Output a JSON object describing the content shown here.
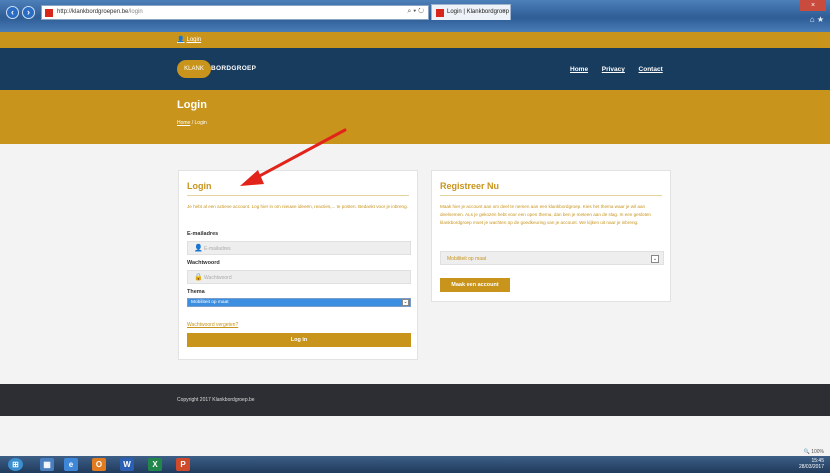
{
  "browser": {
    "url_host": "http://klankbordgroepen.be",
    "url_path": "/login",
    "address_controls": "⌕ ▾ ↻",
    "tab_title": "Login | Klankbordgroep",
    "tab_close": "×",
    "window_controls": "× ",
    "toolbar_icons": "⌂ ★"
  },
  "topbar": {
    "login_link": "Login"
  },
  "header": {
    "logo_badge": "KLANK",
    "logo_word": "BORDGROEP",
    "nav": [
      "Home",
      "Privacy",
      "Contact"
    ]
  },
  "banner": {
    "title": "Login",
    "breadcrumb": [
      "Home",
      "Login"
    ],
    "separator": "/"
  },
  "login_card": {
    "title": "Login",
    "description": "Je hebt al een actieve account. Log hier in om nieuwe ideeën, reacties,... te posten. Bedankt voor je inbreng.",
    "email_label": "E-mailadres",
    "email_placeholder": "E-mailadres",
    "password_label": "Wachtwoord",
    "password_placeholder": "Wachtwoord",
    "theme_label": "Thema",
    "theme_selected": "Mobiliteit op maat",
    "forgot_link": "Wachtwoord vergeten?",
    "submit_label": "Log in"
  },
  "register_card": {
    "title": "Registreer Nu",
    "description": "Maak hier je account aan om deel te nemen aan een klankbordgroep. Kies het thema waar je wil aan deelnemen. ALs je gekozen hebt voor een open thema, dan ben je meteen aan de slag. In een gesloten klankbordgroep moet je wachten op de goedkeuring van je account. We kijken uit naar je inbreng.",
    "theme_selected": "Mobiliteit op maat",
    "button_label": "Maak een account"
  },
  "footer": {
    "copyright": "Copyright 2017 Klankbordgroep.be"
  },
  "status": {
    "zoom": "100%"
  },
  "taskbar": {
    "clock_time": "15:45",
    "clock_date": "28/03/2017"
  },
  "colors": {
    "accent_gold": "#c8941c",
    "header_navy": "#173c5e",
    "footer_dark": "#2c2e33",
    "annotation_red": "#e2231a"
  }
}
